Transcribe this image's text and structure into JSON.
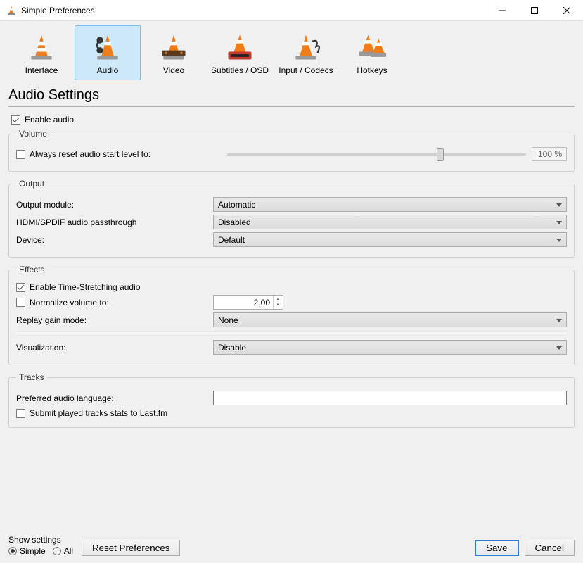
{
  "window": {
    "title": "Simple Preferences"
  },
  "tabs": [
    {
      "id": "interface",
      "label": "Interface"
    },
    {
      "id": "audio",
      "label": "Audio",
      "selected": true
    },
    {
      "id": "video",
      "label": "Video"
    },
    {
      "id": "subtitles",
      "label": "Subtitles / OSD"
    },
    {
      "id": "input",
      "label": "Input / Codecs"
    },
    {
      "id": "hotkeys",
      "label": "Hotkeys"
    }
  ],
  "page_title": "Audio Settings",
  "enable_audio": {
    "label": "Enable audio",
    "checked": true
  },
  "volume": {
    "legend": "Volume",
    "always_reset": {
      "label": "Always reset audio start level to:",
      "checked": false
    },
    "slider_value": 100,
    "slider_display": "100 %",
    "slider_max": 125
  },
  "output": {
    "legend": "Output",
    "module": {
      "label": "Output module:",
      "value": "Automatic"
    },
    "passthrough": {
      "label": "HDMI/SPDIF audio passthrough",
      "value": "Disabled"
    },
    "device": {
      "label": "Device:",
      "value": "Default"
    }
  },
  "effects": {
    "legend": "Effects",
    "time_stretch": {
      "label": "Enable Time-Stretching audio",
      "checked": true
    },
    "normalize": {
      "label": "Normalize volume to:",
      "checked": false,
      "value": "2,00"
    },
    "replay_gain": {
      "label": "Replay gain mode:",
      "value": "None"
    },
    "visualization": {
      "label": "Visualization:",
      "value": "Disable"
    }
  },
  "tracks": {
    "legend": "Tracks",
    "language": {
      "label": "Preferred audio language:",
      "value": ""
    },
    "lastfm": {
      "label": "Submit played tracks stats to Last.fm",
      "checked": false
    }
  },
  "footer": {
    "show_settings_label": "Show settings",
    "simple": "Simple",
    "all": "All",
    "reset": "Reset Preferences",
    "save": "Save",
    "cancel": "Cancel"
  }
}
